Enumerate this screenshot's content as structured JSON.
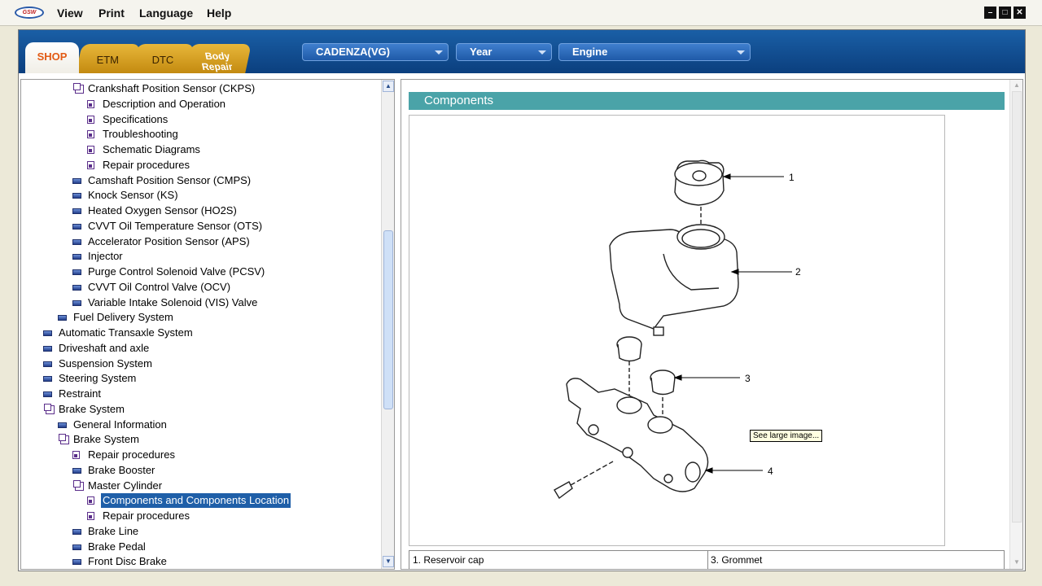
{
  "app": {
    "logo_text": "GSW",
    "menu": [
      "View",
      "Print",
      "Language",
      "Help"
    ],
    "window_controls": [
      "minimize-icon",
      "maximize-icon",
      "close-icon"
    ]
  },
  "tabs": [
    {
      "label": "SHOP",
      "active": true
    },
    {
      "label": "ETM",
      "active": false
    },
    {
      "label": "DTC",
      "active": false
    },
    {
      "label_line1": "Body",
      "label_line2": "Repair",
      "active": false
    }
  ],
  "selectors": {
    "model": "CADENZA(VG)",
    "year": "Year",
    "engine": "Engine"
  },
  "tree": [
    {
      "label": "Crankshaft Position Sensor (CKPS)",
      "level": 3,
      "icon": "open-folder-icon"
    },
    {
      "label": "Description and Operation",
      "level": 4,
      "icon": "page-icon"
    },
    {
      "label": "Specifications",
      "level": 4,
      "icon": "page-icon"
    },
    {
      "label": "Troubleshooting",
      "level": 4,
      "icon": "page-icon"
    },
    {
      "label": "Schematic Diagrams",
      "level": 4,
      "icon": "page-icon"
    },
    {
      "label": "Repair procedures",
      "level": 4,
      "icon": "page-icon"
    },
    {
      "label": "Camshaft Position Sensor (CMPS)",
      "level": 3,
      "icon": "book-icon"
    },
    {
      "label": "Knock Sensor (KS)",
      "level": 3,
      "icon": "book-icon"
    },
    {
      "label": "Heated Oxygen Sensor (HO2S)",
      "level": 3,
      "icon": "book-icon"
    },
    {
      "label": "CVVT Oil Temperature Sensor (OTS)",
      "level": 3,
      "icon": "book-icon"
    },
    {
      "label": "Accelerator Position Sensor (APS)",
      "level": 3,
      "icon": "book-icon"
    },
    {
      "label": "Injector",
      "level": 3,
      "icon": "book-icon"
    },
    {
      "label": "Purge Control Solenoid Valve (PCSV)",
      "level": 3,
      "icon": "book-icon"
    },
    {
      "label": "CVVT Oil Control Valve (OCV)",
      "level": 3,
      "icon": "book-icon"
    },
    {
      "label": "Variable Intake Solenoid (VIS) Valve",
      "level": 3,
      "icon": "book-icon"
    },
    {
      "label": "Fuel Delivery System",
      "level": 2,
      "icon": "book-icon"
    },
    {
      "label": "Automatic Transaxle System",
      "level": 1,
      "icon": "book-icon"
    },
    {
      "label": "Driveshaft and axle",
      "level": 1,
      "icon": "book-icon"
    },
    {
      "label": "Suspension System",
      "level": 1,
      "icon": "book-icon"
    },
    {
      "label": "Steering System",
      "level": 1,
      "icon": "book-icon"
    },
    {
      "label": "Restraint",
      "level": 1,
      "icon": "book-icon"
    },
    {
      "label": "Brake System",
      "level": 1,
      "icon": "open-folder-icon"
    },
    {
      "label": "General Information",
      "level": 2,
      "icon": "book-icon"
    },
    {
      "label": "Brake System",
      "level": 2,
      "icon": "open-folder-icon"
    },
    {
      "label": "Repair procedures",
      "level": 3,
      "icon": "page-icon"
    },
    {
      "label": "Brake Booster",
      "level": 3,
      "icon": "book-icon"
    },
    {
      "label": "Master Cylinder",
      "level": 3,
      "icon": "open-folder-icon"
    },
    {
      "label": "Components and Components Location",
      "level": 4,
      "icon": "page-icon",
      "selected": true
    },
    {
      "label": "Repair procedures",
      "level": 4,
      "icon": "page-icon"
    },
    {
      "label": "Brake Line",
      "level": 3,
      "icon": "book-icon"
    },
    {
      "label": "Brake Pedal",
      "level": 3,
      "icon": "book-icon"
    },
    {
      "label": "Front Disc Brake",
      "level": 3,
      "icon": "book-icon"
    }
  ],
  "content": {
    "section_title": "Components",
    "figure_callouts": [
      "1",
      "2",
      "3",
      "4"
    ],
    "tooltip": "See large image...",
    "legend": {
      "left": "1. Reservoir cap",
      "right": "3. Grommet"
    }
  },
  "colors": {
    "topbar": "#0b3f7e",
    "tab_active_text": "#e25a14",
    "tab_inactive": "#c38a10",
    "section_bar": "#4aa3a8",
    "selection": "#1f5fa8"
  }
}
